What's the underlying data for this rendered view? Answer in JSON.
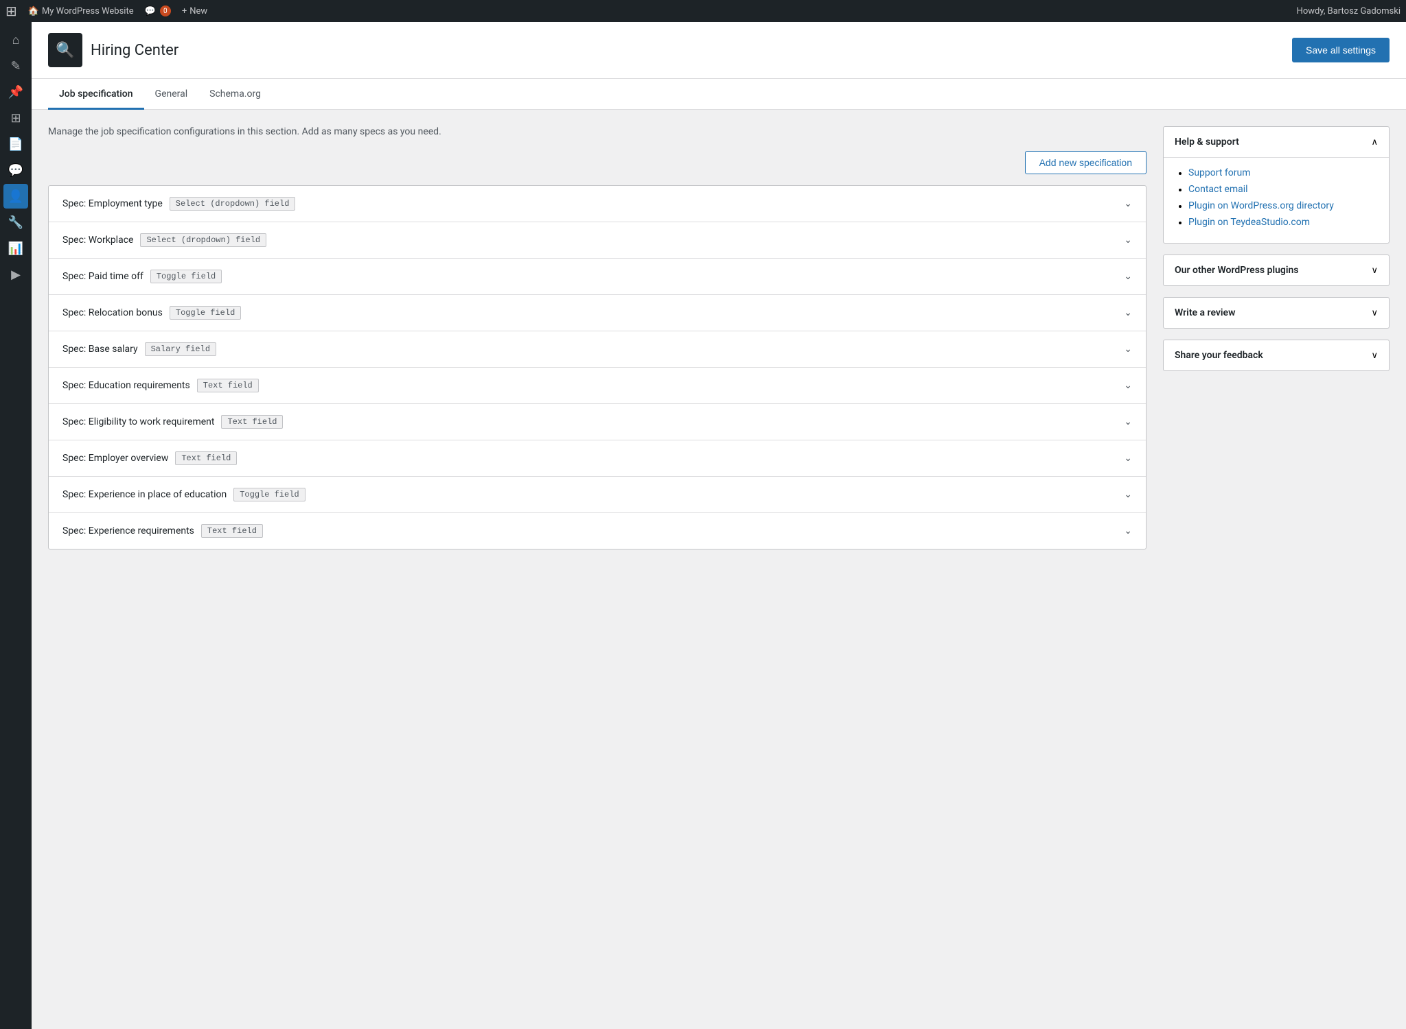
{
  "adminbar": {
    "logo": "⊞",
    "site_name": "My WordPress Website",
    "comments_label": "Comments",
    "comments_count": "0",
    "new_label": "New",
    "howdy": "Howdy, Bartosz Gadomski"
  },
  "sidebar": {
    "icons": [
      {
        "name": "dashboard-icon",
        "glyph": "⌂"
      },
      {
        "name": "posts-icon",
        "glyph": "✎"
      },
      {
        "name": "pin-icon",
        "glyph": "📌"
      },
      {
        "name": "plugins-icon",
        "glyph": "⊞"
      },
      {
        "name": "pages-icon",
        "glyph": "📄"
      },
      {
        "name": "comments-icon",
        "glyph": "💬"
      },
      {
        "name": "user-icon",
        "glyph": "👤",
        "active": true
      },
      {
        "name": "tools-icon",
        "glyph": "🔧"
      },
      {
        "name": "analytics-icon",
        "glyph": "📊"
      },
      {
        "name": "media-icon",
        "glyph": "▶"
      }
    ]
  },
  "header": {
    "logo_symbol": "🔍",
    "title": "Hiring Center",
    "save_button_label": "Save all settings"
  },
  "tabs": [
    {
      "id": "job-spec",
      "label": "Job specification",
      "active": true
    },
    {
      "id": "general",
      "label": "General"
    },
    {
      "id": "schema",
      "label": "Schema.org"
    }
  ],
  "description": "Manage the job specification configurations in this section. Add as many specs as you need.",
  "add_spec_button": "Add new specification",
  "specs": [
    {
      "name": "Spec: Employment type",
      "badge": "Select (dropdown) field"
    },
    {
      "name": "Spec: Workplace",
      "badge": "Select (dropdown) field"
    },
    {
      "name": "Spec: Paid time off",
      "badge": "Toggle field"
    },
    {
      "name": "Spec: Relocation bonus",
      "badge": "Toggle field"
    },
    {
      "name": "Spec: Base salary",
      "badge": "Salary field"
    },
    {
      "name": "Spec: Education requirements",
      "badge": "Text field"
    },
    {
      "name": "Spec: Eligibility to work requirement",
      "badge": "Text field"
    },
    {
      "name": "Spec: Employer overview",
      "badge": "Text field"
    },
    {
      "name": "Spec: Experience in place of education",
      "badge": "Toggle field"
    },
    {
      "name": "Spec: Experience requirements",
      "badge": "Text field"
    }
  ],
  "sidebar_cards": [
    {
      "id": "help-support",
      "title": "Help & support",
      "expanded": true,
      "links": [
        {
          "label": "Support forum",
          "href": "#"
        },
        {
          "label": "Contact email",
          "href": "#"
        },
        {
          "label": "Plugin on WordPress.org directory",
          "href": "#"
        },
        {
          "label": "Plugin on TeydeaStudio.com",
          "href": "#"
        }
      ]
    },
    {
      "id": "other-plugins",
      "title": "Our other WordPress plugins",
      "expanded": false
    },
    {
      "id": "write-review",
      "title": "Write a review",
      "expanded": false
    },
    {
      "id": "share-feedback",
      "title": "Share your feedback",
      "expanded": false
    }
  ]
}
